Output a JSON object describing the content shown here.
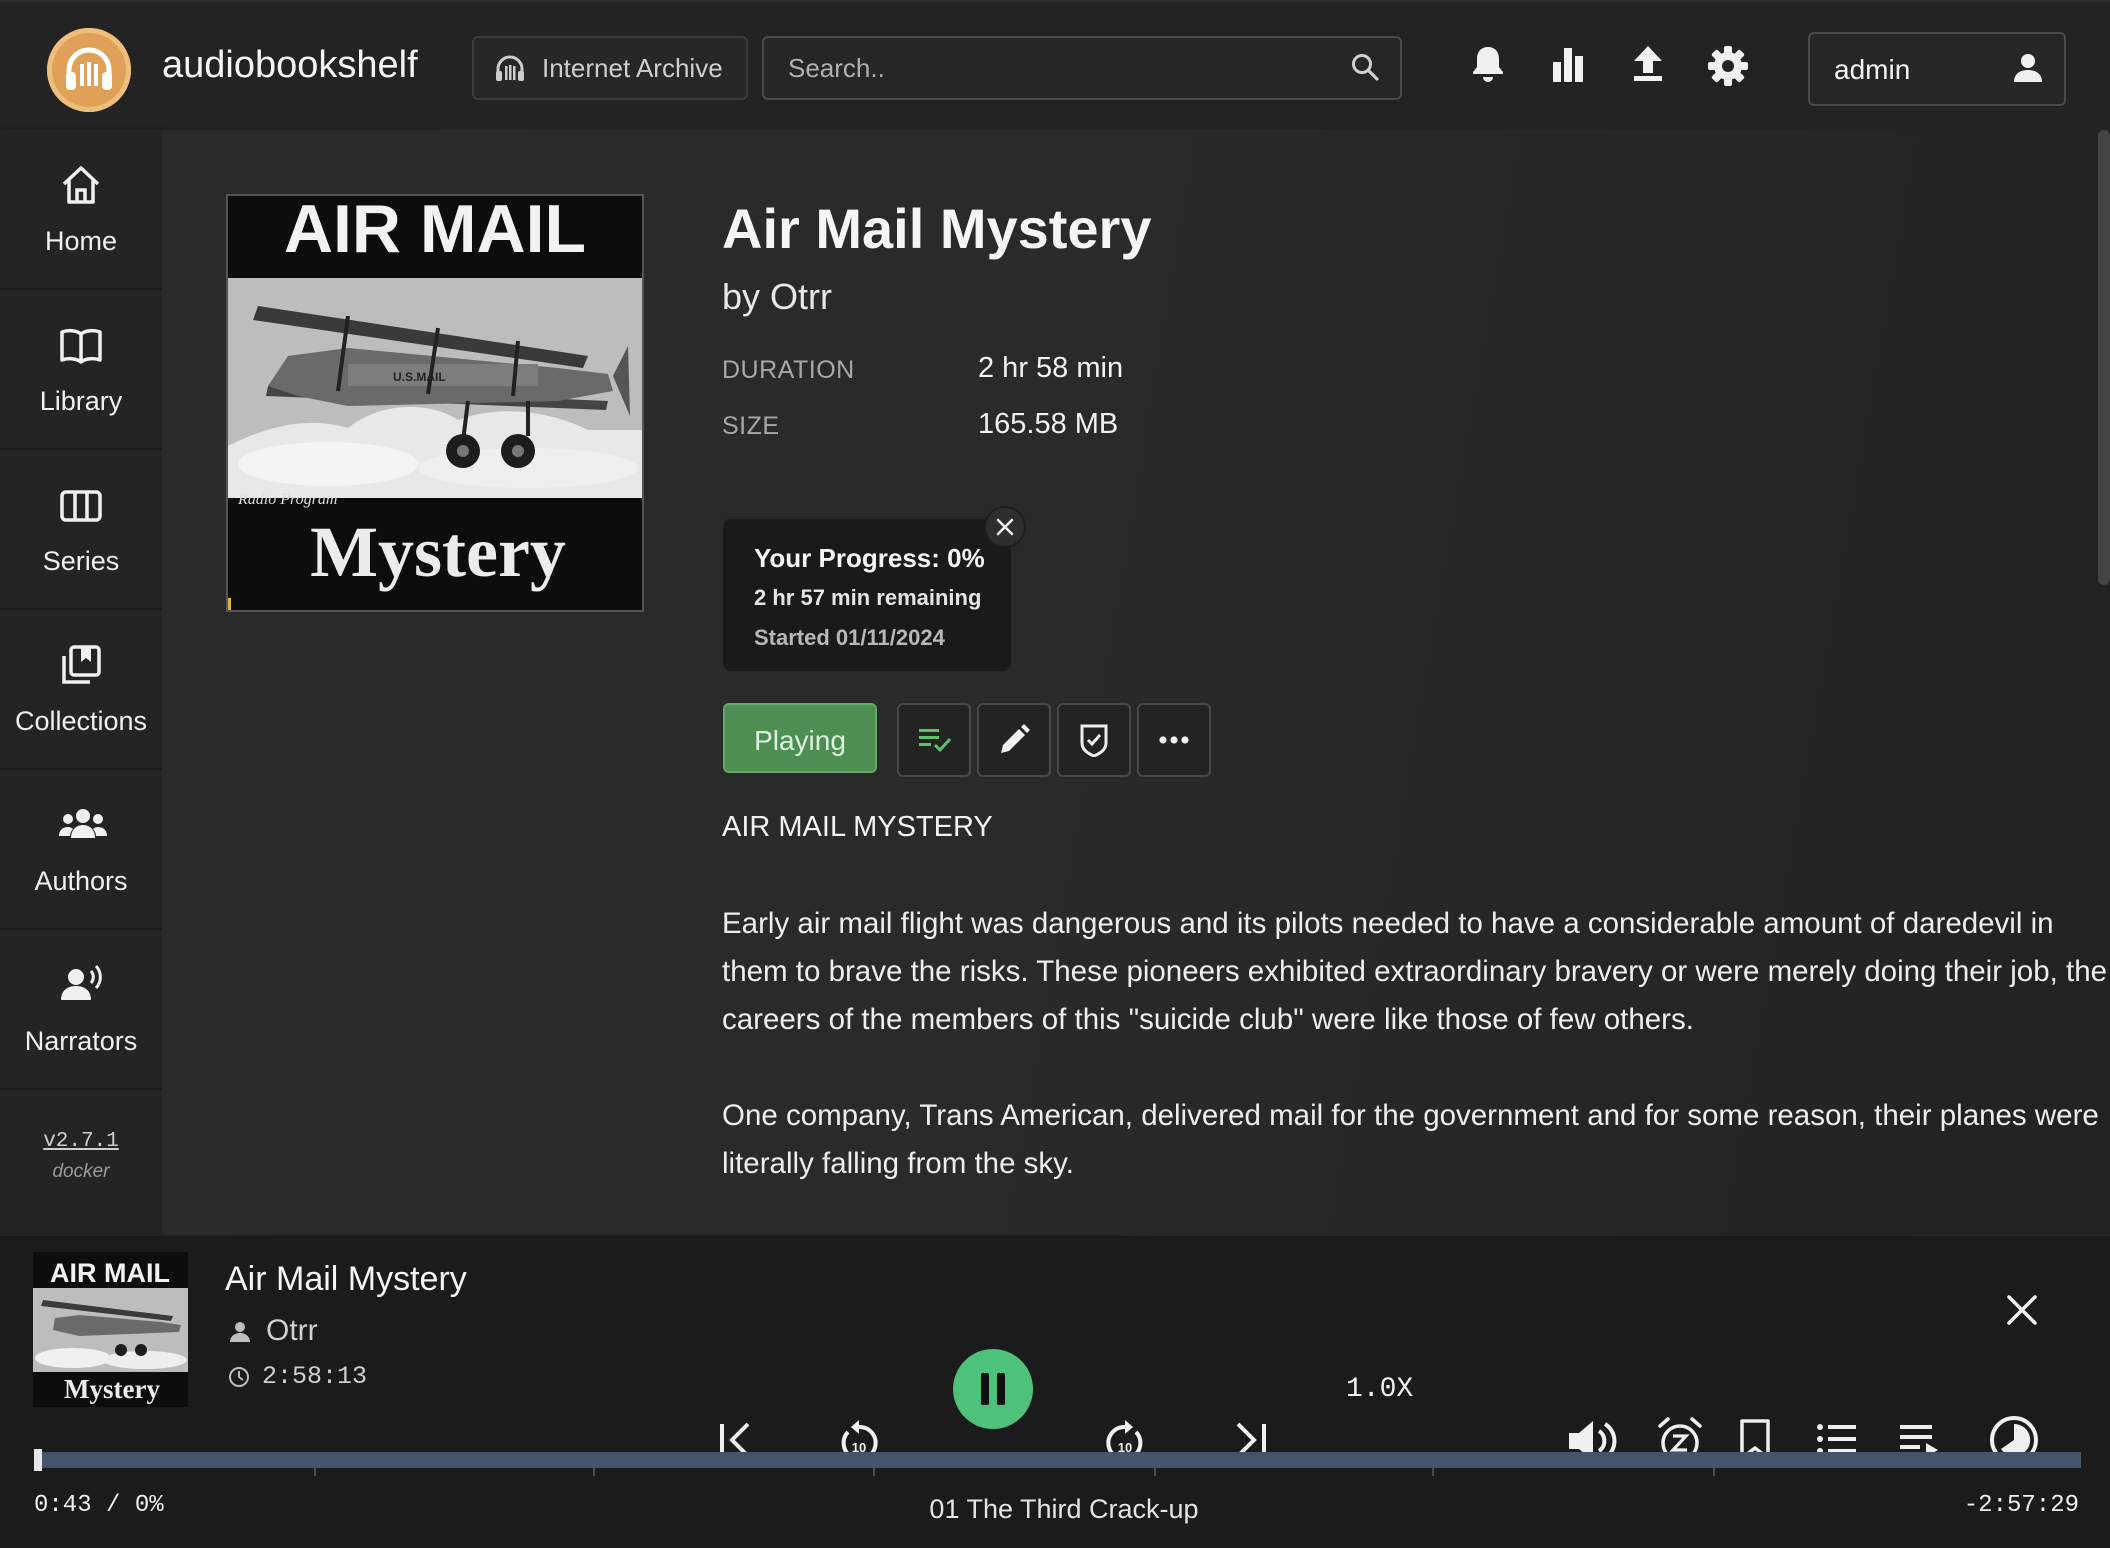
{
  "app": {
    "name": "audiobookshelf",
    "library": "Internet Archive",
    "search_placeholder": "Search..",
    "user": "admin",
    "accent": "#4d8f52"
  },
  "sidebar": {
    "items": [
      {
        "label": "Home",
        "icon": "home-icon"
      },
      {
        "label": "Library",
        "icon": "book-open-icon"
      },
      {
        "label": "Series",
        "icon": "columns-icon"
      },
      {
        "label": "Collections",
        "icon": "collections-icon"
      },
      {
        "label": "Authors",
        "icon": "authors-icon"
      },
      {
        "label": "Narrators",
        "icon": "narrator-icon"
      }
    ],
    "version": "v2.7.1",
    "build": "docker"
  },
  "book": {
    "title": "Air Mail Mystery",
    "byline": "by Otrr",
    "cover": {
      "top_text": "AIR MAIL",
      "band_text": "Radio Program",
      "bottom_text": "Mystery",
      "plane_text": "U.S.MAIL"
    },
    "meta": [
      {
        "label": "DURATION",
        "value": "2 hr 58 min"
      },
      {
        "label": "SIZE",
        "value": "165.58 MB"
      }
    ],
    "progress": {
      "headline": "Your Progress: 0%",
      "remaining": "2 hr 57 min remaining",
      "started": "Started 01/11/2024",
      "percent": 0
    },
    "actions": {
      "play_label": "Playing"
    },
    "subtitle": "AIR MAIL MYSTERY",
    "description": [
      "Early air mail flight was dangerous and its pilots needed to have a considerable amount of daredevil in them to brave the risks. These pioneers exhibited extraordinary bravery or were merely doing their job, the careers of the members of this \"suicide club\" were like those of few others.",
      "One company, Trans American, delivered mail for the government and for some reason, their planes were literally falling from the sky."
    ]
  },
  "player": {
    "title": "Air Mail Mystery",
    "author": "Otrr",
    "duration": "2:58:13",
    "speed": "1.0X",
    "current": "0:43",
    "percent_label": "0%",
    "remaining": "-2:57:29",
    "chapter": "01 The Third Crack-up",
    "progress_fraction": 0.004,
    "chapter_marks": [
      0.137,
      0.273,
      0.41,
      0.547,
      0.683,
      0.82
    ],
    "cover": {
      "top_text": "AIR MAIL",
      "bottom_text": "Mystery"
    }
  }
}
